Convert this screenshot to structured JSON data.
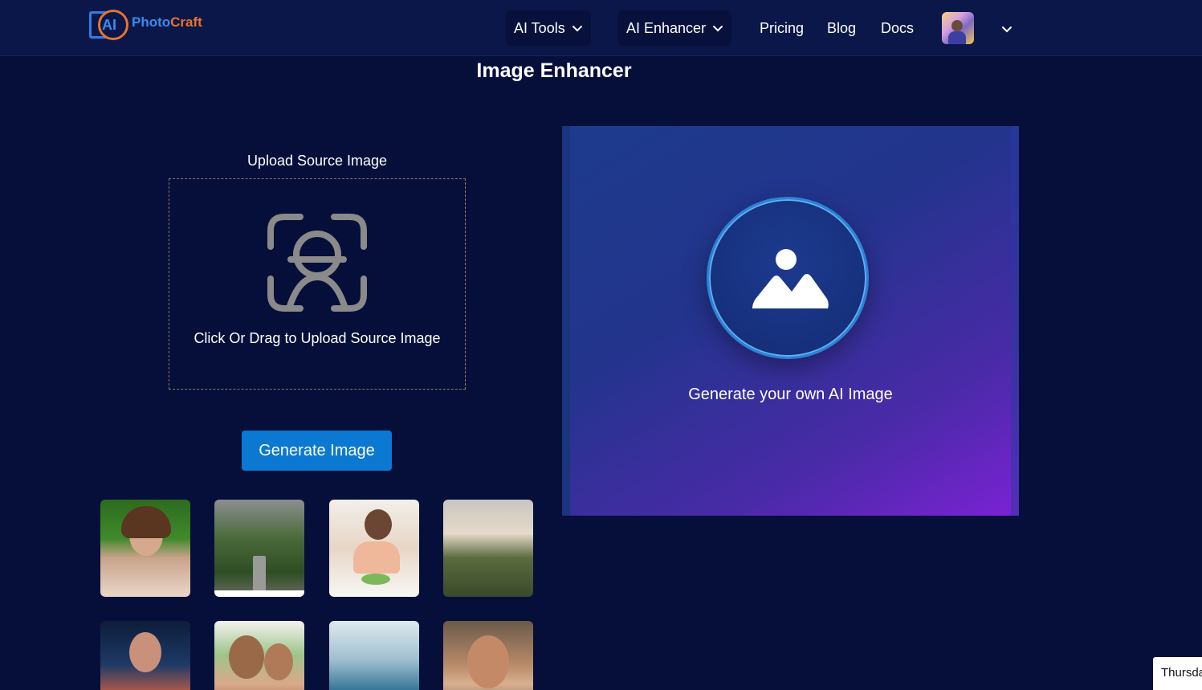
{
  "header": {
    "logo": {
      "mark": "AI",
      "text_part1": "Photo",
      "text_part2": "Craft"
    },
    "nav": {
      "ai_tools": "AI Tools",
      "ai_enhancer": "AI Enhancer",
      "pricing": "Pricing",
      "blog": "Blog",
      "docs": "Docs"
    },
    "icons": {
      "dropdown": "chevron-down-icon",
      "avatar": "user-avatar"
    }
  },
  "page": {
    "title": "Image Enhancer"
  },
  "upload": {
    "label": "Upload Source Image",
    "dropzone_text": "Click Or Drag to Upload Source Image",
    "icon": "face-scan-icon"
  },
  "actions": {
    "generate_label": "Generate Image"
  },
  "samples": [
    {
      "name": "sample-woman-portrait"
    },
    {
      "name": "sample-forest-road"
    },
    {
      "name": "sample-woman-eating"
    },
    {
      "name": "sample-landscape-field"
    },
    {
      "name": "sample-man-portrait"
    },
    {
      "name": "sample-mother-daughter"
    },
    {
      "name": "sample-coastline"
    },
    {
      "name": "sample-older-man-portrait"
    }
  ],
  "preview": {
    "text": "Generate your own AI Image",
    "icon": "image-icon"
  },
  "toast": {
    "text": "Thursda"
  },
  "colors": {
    "background": "#060f3a",
    "header": "#0b1748",
    "primary_button": "#0b78d1",
    "logo_blue": "#3b8bf0",
    "logo_orange": "#e8742d"
  }
}
